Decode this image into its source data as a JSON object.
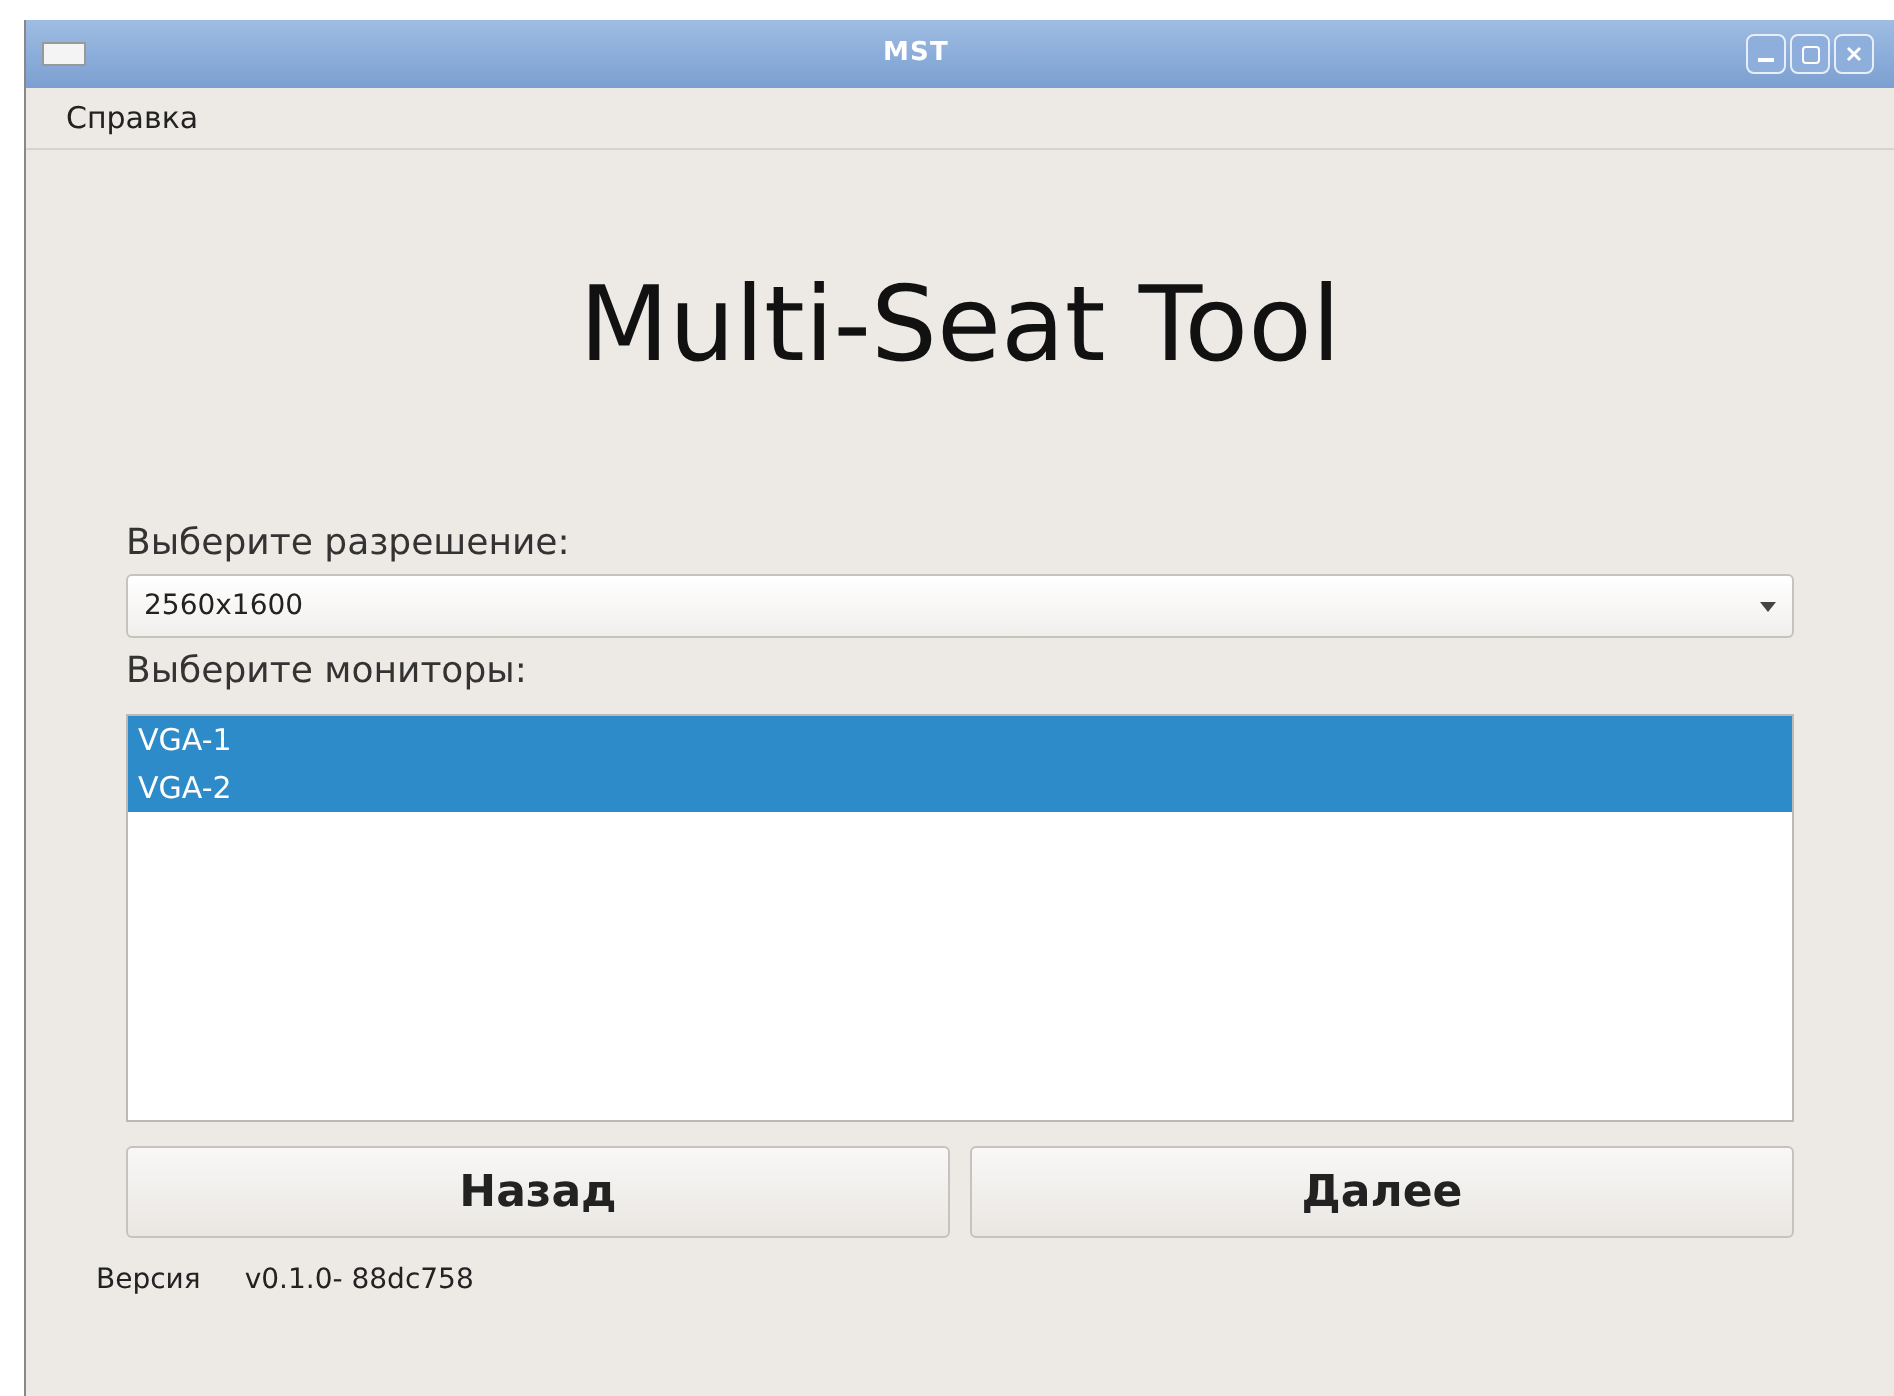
{
  "window": {
    "title": "MST"
  },
  "menu": [
    "Справка"
  ],
  "heading": "Multi-Seat Tool",
  "resolution": {
    "label": "Выберите разрешение:",
    "value": "2560x1600"
  },
  "monitors": {
    "label": "Выберите мониторы:",
    "items": [
      {
        "name": "VGA-1",
        "selected": true
      },
      {
        "name": "VGA-2",
        "selected": true
      }
    ]
  },
  "buttons": [
    "Назад",
    "Далее"
  ],
  "version": {
    "label": "Версия",
    "value": "v0.1.0- 88dc758"
  }
}
